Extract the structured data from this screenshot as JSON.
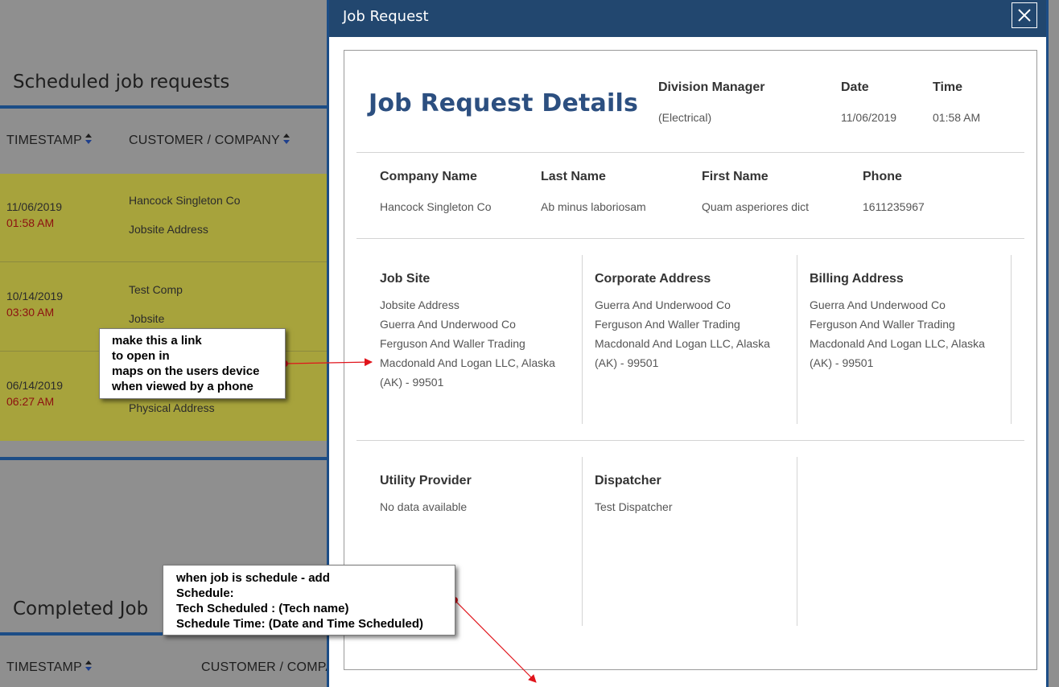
{
  "background": {
    "scheduled_title": "Scheduled job requests",
    "completed_title": "Completed Job",
    "headers": {
      "timestamp": "TIMESTAMP",
      "customer": "CUSTOMER / COMPANY",
      "customer_truncated": "CUSTOMER / COMPA"
    },
    "rows": [
      {
        "date": "11/06/2019",
        "time": "01:58 AM",
        "company": "Hancock Singleton Co",
        "address": "Jobsite Address"
      },
      {
        "date": "10/14/2019",
        "time": "03:30 AM",
        "company": "Test Comp",
        "address": "Jobsite"
      },
      {
        "date": "06/14/2019",
        "time": "06:27 AM",
        "company": "",
        "address": "Physical Address"
      }
    ]
  },
  "modal": {
    "title": "Job Request",
    "details_title": "Job Request Details",
    "division_manager": {
      "label": "Division Manager",
      "value": "(Electrical)"
    },
    "date": {
      "label": "Date",
      "value": "11/06/2019"
    },
    "time": {
      "label": "Time",
      "value": "01:58 AM"
    },
    "company_name": {
      "label": "Company Name",
      "value": "Hancock Singleton Co"
    },
    "last_name": {
      "label": "Last Name",
      "value": "Ab minus laboriosam"
    },
    "first_name": {
      "label": "First Name",
      "value": "Quam asperiores dict"
    },
    "phone": {
      "label": "Phone",
      "value": "1611235967"
    },
    "job_site": {
      "label": "Job Site",
      "lines": [
        "Jobsite Address",
        "Guerra And Underwood Co",
        "Ferguson And Waller Trading",
        "Macdonald And Logan LLC, Alaska",
        "(AK) - 99501"
      ]
    },
    "corporate_address": {
      "label": "Corporate Address",
      "lines": [
        "Guerra And Underwood Co",
        "Ferguson And Waller Trading",
        "Macdonald And Logan LLC, Alaska",
        "(AK) - 99501"
      ]
    },
    "billing_address": {
      "label": "Billing Address",
      "lines": [
        "Guerra And Underwood Co",
        "Ferguson And Waller Trading",
        "Macdonald And Logan LLC, Alaska",
        "(AK) - 99501"
      ]
    },
    "utility_provider": {
      "label": "Utility Provider",
      "value": "No data available"
    },
    "dispatcher": {
      "label": "Dispatcher",
      "value": "Test Dispatcher"
    }
  },
  "annotations": {
    "link_note": [
      "make this a link",
      "to open in",
      "maps on the users device",
      "when viewed by a phone"
    ],
    "schedule_note": [
      "when job is schedule - add",
      "Schedule:",
      "Tech Scheduled : (Tech name)",
      "Schedule Time: (Date and Time Scheduled)"
    ],
    "arrow_color": "#e0141b"
  },
  "colors": {
    "modal_header": "#22476f",
    "accent_blue": "#1c4d86",
    "title_blue": "#2c4f80",
    "row_highlight": "#a7a33c",
    "time_red": "#8d1010"
  }
}
